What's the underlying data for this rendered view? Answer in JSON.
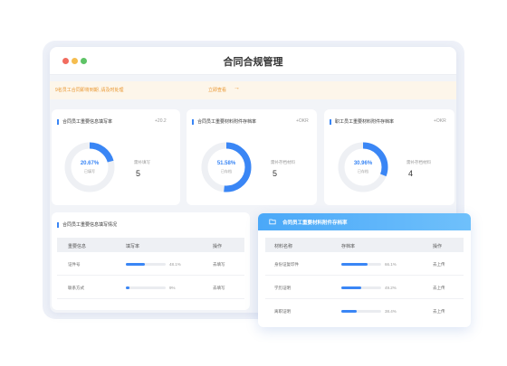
{
  "window": {
    "title": "合同合规管理"
  },
  "notice": {
    "text": "9名员工合同即将到期 ,请及时处理",
    "link": "立即查看"
  },
  "cards": [
    {
      "title": "合同员工重要信息填写率",
      "tag": "+20.2",
      "percent": "20.67%",
      "percent_value": 20.67,
      "sub": "已填写",
      "stat_label": "需补填写",
      "stat_value": "5"
    },
    {
      "title": "合同员工重要材料附件存档率",
      "tag": "+OKR",
      "percent": "51.58%",
      "percent_value": 51.58,
      "sub": "已存档",
      "stat_label": "需补存档材料",
      "stat_value": "5"
    },
    {
      "title": "职工员工重要材料附件存档率",
      "tag": "+OKR",
      "percent": "30.96%",
      "percent_value": 30.96,
      "sub": "已存档",
      "stat_label": "需补存档材料",
      "stat_value": "4"
    }
  ],
  "left_table": {
    "title": "合同员工重要信息填写情况",
    "headers": [
      "重要信息",
      "填写率",
      "操作"
    ],
    "rows": [
      {
        "name": "证件号",
        "pct": "48.1%",
        "value": 48.1,
        "action": "去填写"
      },
      {
        "name": "联系方式",
        "pct": "9%",
        "value": 9,
        "action": "去填写"
      }
    ]
  },
  "popup": {
    "title": "合同员工重要材料附件存档率",
    "headers": [
      "材料名称",
      "存档率",
      "操作"
    ],
    "rows": [
      {
        "name": "身份证复印件",
        "pct": "66.1%",
        "value": 66.1,
        "action": "去上传"
      },
      {
        "name": "学历证明",
        "pct": "49.2%",
        "value": 49.2,
        "action": "去上传"
      },
      {
        "name": "离职证明",
        "pct": "38.4%",
        "value": 38.4,
        "action": "去上传"
      }
    ]
  },
  "colors": {
    "accent": "#3a86f5",
    "track": "#eef0f4",
    "warning": "#e9962e"
  }
}
